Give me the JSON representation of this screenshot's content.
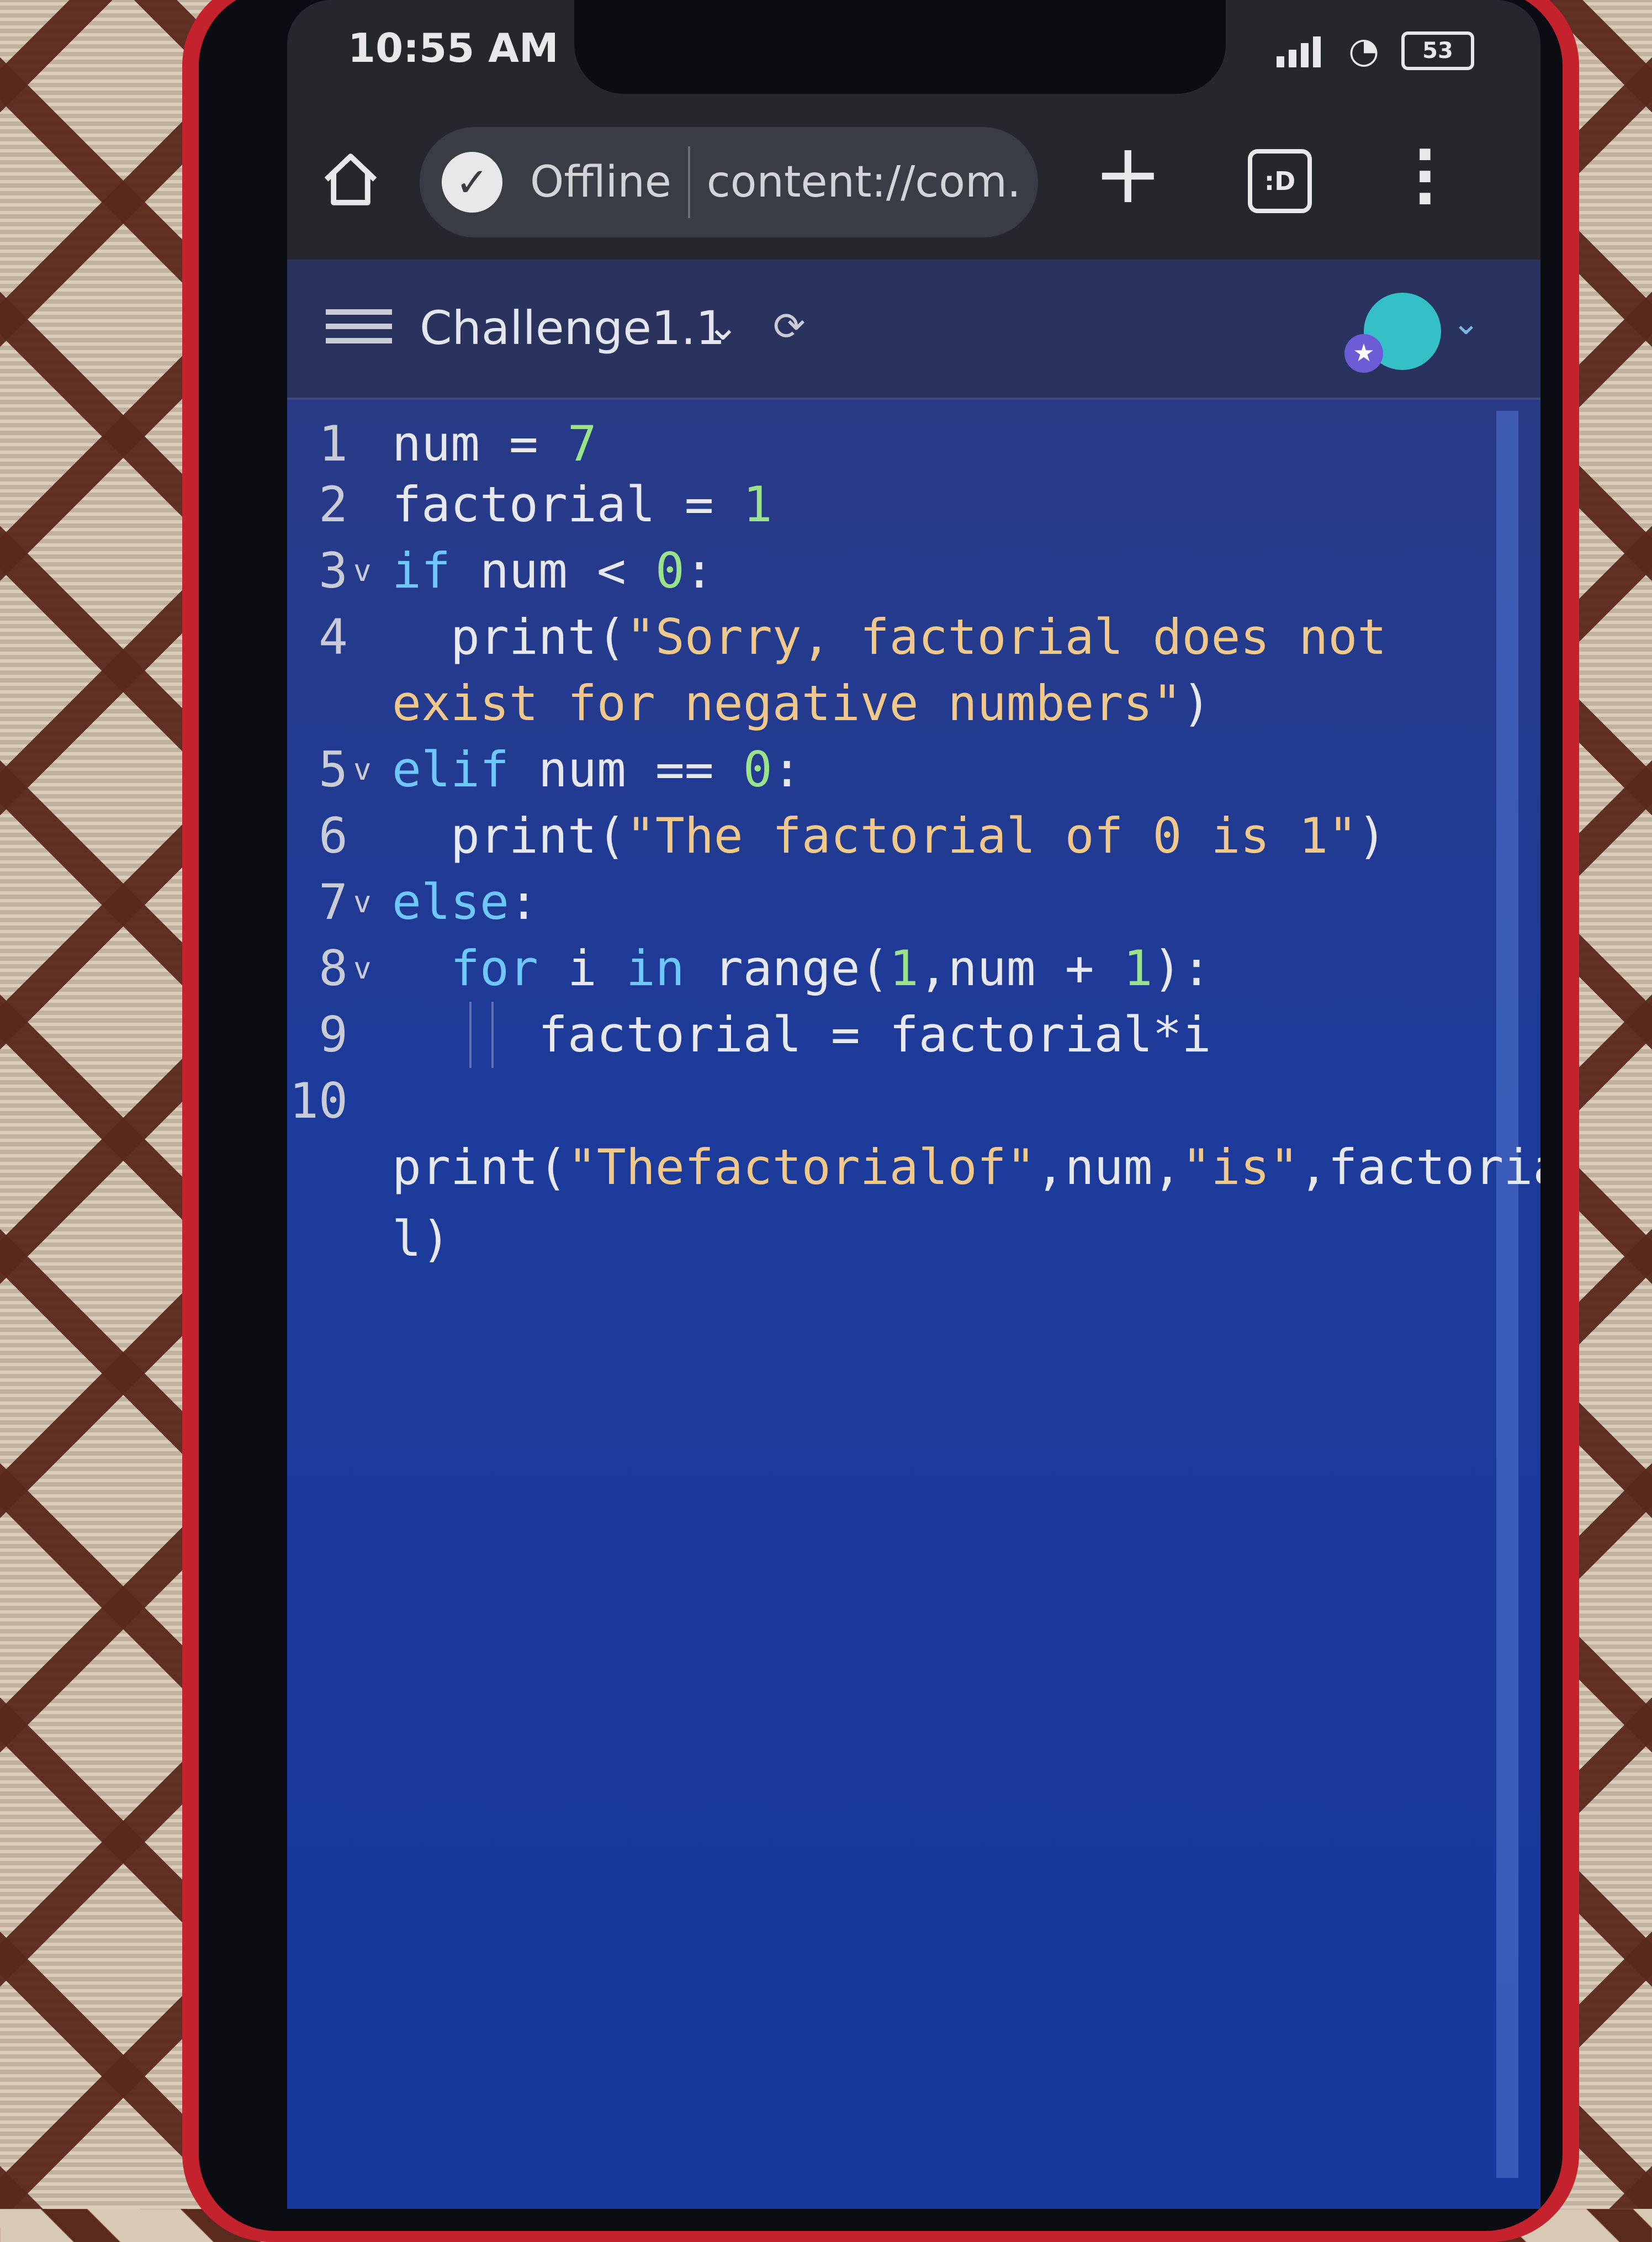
{
  "status_bar": {
    "time": "10:55 AM",
    "battery": "53"
  },
  "browser": {
    "offline_label": "Offline",
    "url": "content://com.",
    "tabs_label": ":D"
  },
  "app_bar": {
    "document_title": "Challenge1.1"
  },
  "editor": {
    "lines": [
      {
        "number": "1",
        "fold": "",
        "indent": "",
        "tokens": [
          [
            "id",
            "num"
          ],
          [
            "op",
            " = "
          ],
          [
            "num",
            "7"
          ]
        ]
      },
      {
        "number": "2",
        "fold": "",
        "indent": "",
        "tokens": [
          [
            "id",
            "factorial"
          ],
          [
            "op",
            " = "
          ],
          [
            "num",
            "1"
          ]
        ]
      },
      {
        "number": "3",
        "fold": "v",
        "indent": "",
        "tokens": [
          [
            "kw",
            "if"
          ],
          [
            "id",
            " num "
          ],
          [
            "op",
            "< "
          ],
          [
            "num",
            "0"
          ],
          [
            "op",
            ":"
          ]
        ]
      },
      {
        "number": "4",
        "fold": "",
        "indent": "  ",
        "tokens": [
          [
            "id",
            "print"
          ],
          [
            "op",
            "("
          ],
          [
            "str",
            "\"Sorry, factorial does not"
          ]
        ]
      },
      {
        "number": "",
        "fold": "",
        "indent": "",
        "tokens": [
          [
            "str",
            "exist for negative numbers\""
          ],
          [
            "op",
            ")"
          ]
        ]
      },
      {
        "number": "5",
        "fold": "v",
        "indent": "",
        "tokens": [
          [
            "kw",
            "elif"
          ],
          [
            "id",
            " num "
          ],
          [
            "op",
            "== "
          ],
          [
            "num",
            "0"
          ],
          [
            "op",
            ":"
          ]
        ]
      },
      {
        "number": "6",
        "fold": "",
        "indent": "  ",
        "tokens": [
          [
            "id",
            "print"
          ],
          [
            "op",
            "("
          ],
          [
            "str",
            "\"The factorial of 0 is 1\""
          ],
          [
            "op",
            ")"
          ]
        ]
      },
      {
        "number": "7",
        "fold": "v",
        "indent": "",
        "tokens": [
          [
            "kw",
            "else"
          ],
          [
            "op",
            ":"
          ]
        ]
      },
      {
        "number": "8",
        "fold": "v",
        "indent": "  ",
        "tokens": [
          [
            "kw",
            "for"
          ],
          [
            "id",
            " i "
          ],
          [
            "kw",
            "in"
          ],
          [
            "id",
            " range"
          ],
          [
            "op",
            "("
          ],
          [
            "num",
            "1"
          ],
          [
            "op",
            ","
          ],
          [
            "id",
            "num "
          ],
          [
            "op",
            "+ "
          ],
          [
            "num",
            "1"
          ],
          [
            "op",
            "):"
          ]
        ]
      },
      {
        "number": "9",
        "fold": "",
        "indent": "     ",
        "tokens": [
          [
            "id",
            "factorial "
          ],
          [
            "op",
            "= "
          ],
          [
            "id",
            "factorial"
          ],
          [
            "op",
            "*"
          ],
          [
            "id",
            "i"
          ]
        ]
      },
      {
        "number": "10",
        "fold": "",
        "indent": "",
        "tokens": []
      },
      {
        "number": "",
        "fold": "",
        "indent": "",
        "tokens": [
          [
            "id",
            "print"
          ],
          [
            "op",
            "("
          ],
          [
            "str",
            "\"Thefactorialof\""
          ],
          [
            "op",
            ","
          ],
          [
            "id",
            "num"
          ],
          [
            "op",
            ","
          ],
          [
            "str",
            "\"is\""
          ],
          [
            "op",
            ","
          ],
          [
            "id",
            "factoria"
          ]
        ]
      },
      {
        "number": "",
        "fold": "",
        "indent": "",
        "tokens": [
          [
            "id",
            "l"
          ],
          [
            "op",
            ")"
          ]
        ]
      }
    ]
  },
  "icons": {
    "home": "home-icon",
    "offline_check": "check-circle-icon",
    "new_tab": "plus-icon",
    "tab_switcher": "tab-switcher-icon",
    "overflow_menu": "more-vert-icon",
    "menu": "hamburger-menu-icon",
    "title_dropdown": "chevron-down-icon",
    "sync": "cloud-sync-icon",
    "avatar": "user-avatar-icon"
  },
  "colors": {
    "editor_background": "#1c3a9a",
    "keyword": "#6ec7ff",
    "string": "#f0c88a",
    "number": "#9ae38a",
    "phone_case": "#c4222d"
  }
}
